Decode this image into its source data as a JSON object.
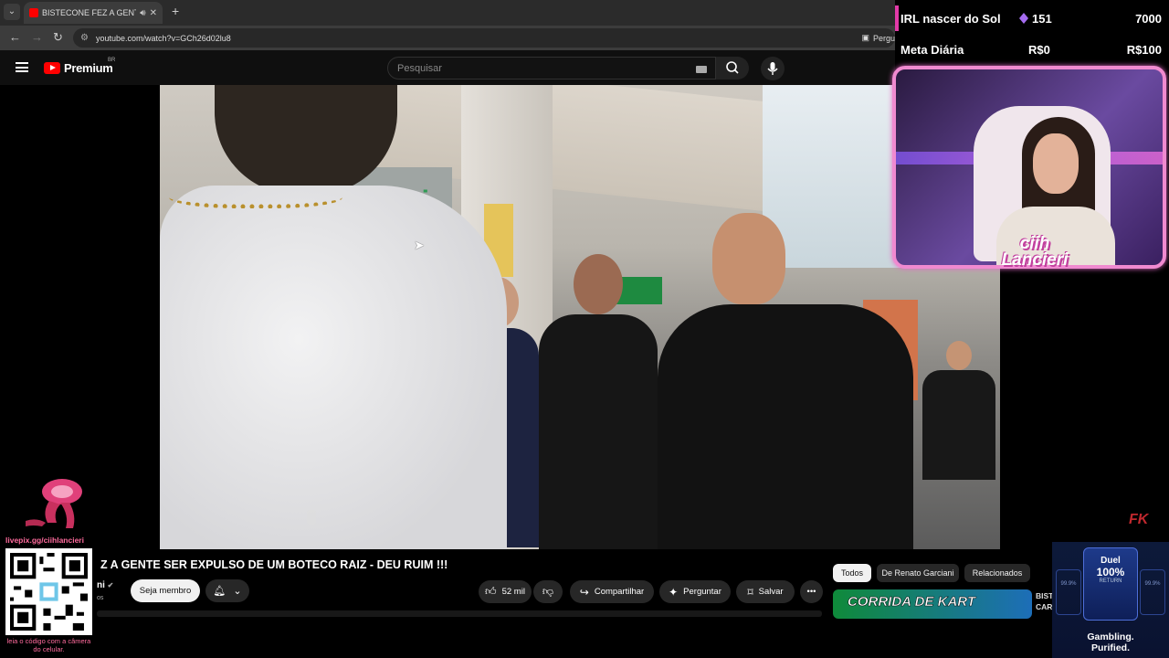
{
  "browser": {
    "tab_title": "BISTECONE FEZ A GENTE SE",
    "new_tab": "+",
    "url": "youtube.com/watch?v=GCh26d02lu8",
    "ask_label": "Pergu"
  },
  "youtube": {
    "logo_text": "Premium",
    "region": "BR",
    "search_placeholder": "Pesquisar"
  },
  "video": {
    "title": "Z A GENTE SER EXPULSO DE UM BOTECO RAIZ - DEU RUIM !!!",
    "channel": "ni",
    "subs": "os",
    "member_button": "Seja membro",
    "likes": "52 mil",
    "share": "Compartilhar",
    "ask": "Perguntar",
    "save": "Salvar"
  },
  "chips": [
    "Todos",
    "De Renato Garciani",
    "Relacionados"
  ],
  "recommended": {
    "thumb_text": "CORRIDA DE KART",
    "meta_line1": "BIST",
    "meta_line2": "CAR"
  },
  "overlay": {
    "goal1_label": "IRL nascer do Sol",
    "goal1_count": "151",
    "goal1_target": "7000",
    "goal2_label": "Meta Diária",
    "goal2_current": "R$0",
    "goal2_target": "R$100",
    "streamer_name_1": "ciih",
    "streamer_name_2": "Lancieri",
    "livepix": "livepix.gg/ciihlancieri",
    "qr_hint": "leia o código com a câmera do celular.",
    "duel_title": "Duel",
    "duel_pct": "100%",
    "duel_sub": "RETURN",
    "duel_left": "99.9%",
    "duel_right": "99.9%",
    "duel_slogan_1": "Gambling.",
    "duel_slogan_2": "Purified.",
    "watermark": "FK"
  },
  "colors": {
    "youtube_red": "#ff0000",
    "overlay_pink": "#f08ad0",
    "gem_purple": "#a56cf0"
  }
}
